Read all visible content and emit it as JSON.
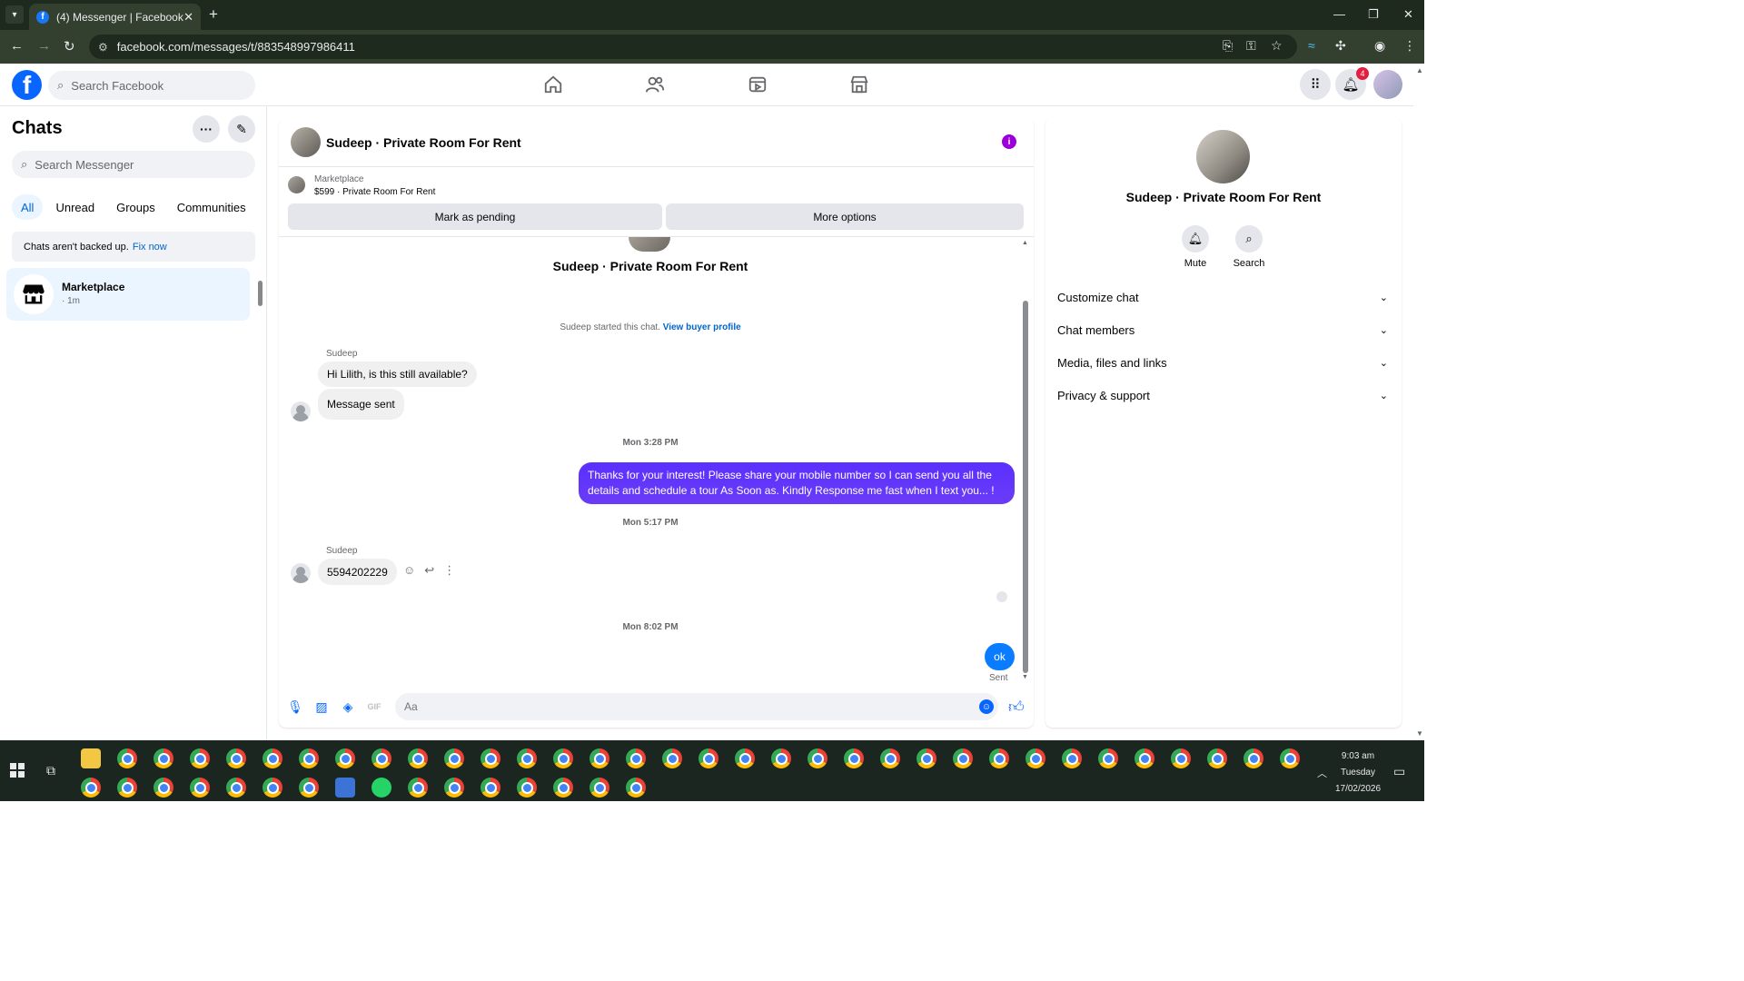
{
  "browser": {
    "tab_title": "(4) Messenger | Facebook",
    "url": "facebook.com/messages/t/883548997986411"
  },
  "fb": {
    "search_placeholder": "Search Facebook",
    "notification_count": "4"
  },
  "chats": {
    "title": "Chats",
    "search_placeholder": "Search Messenger",
    "filters": [
      "All",
      "Unread",
      "Groups",
      "Communities"
    ],
    "backup_text": "Chats aren't backed up.",
    "backup_link": "Fix now",
    "items": [
      {
        "name": "Marketplace",
        "time": "· 1m"
      }
    ]
  },
  "conversation": {
    "title": "Sudeep · Private Room For Rent",
    "marketplace_label": "Marketplace",
    "listing": "$599 · Private Room For Rent",
    "mark_pending": "Mark as pending",
    "more_options": "More options",
    "thread_title": "Sudeep · Private Room For Rent",
    "started_text": "Sudeep started this chat.",
    "view_profile": "View buyer profile",
    "messages": [
      {
        "sender": "Sudeep",
        "text": "Hi Lilith, is this still available?"
      },
      {
        "text": "Message sent"
      },
      {
        "separator": "Mon 3:28 PM"
      },
      {
        "text": "Thanks for your interest! Please share your mobile number so I can send you all the details and schedule a tour As Soon as. Kindly Response me fast when I text you... !"
      },
      {
        "separator": "Mon 5:17 PM"
      },
      {
        "sender": "Sudeep",
        "text": "5594202229"
      },
      {
        "separator": "Mon 8:02 PM"
      },
      {
        "text": "ok",
        "status": "Sent"
      }
    ],
    "composer_placeholder": "Aa"
  },
  "info": {
    "name": "Sudeep · Private Room For Rent",
    "actions": [
      "Mute",
      "Search"
    ],
    "sections": [
      "Customize chat",
      "Chat members",
      "Media, files and links",
      "Privacy & support"
    ]
  },
  "taskbar": {
    "time": "9:03 am",
    "day": "Tuesday",
    "date": "17/02/2026"
  }
}
